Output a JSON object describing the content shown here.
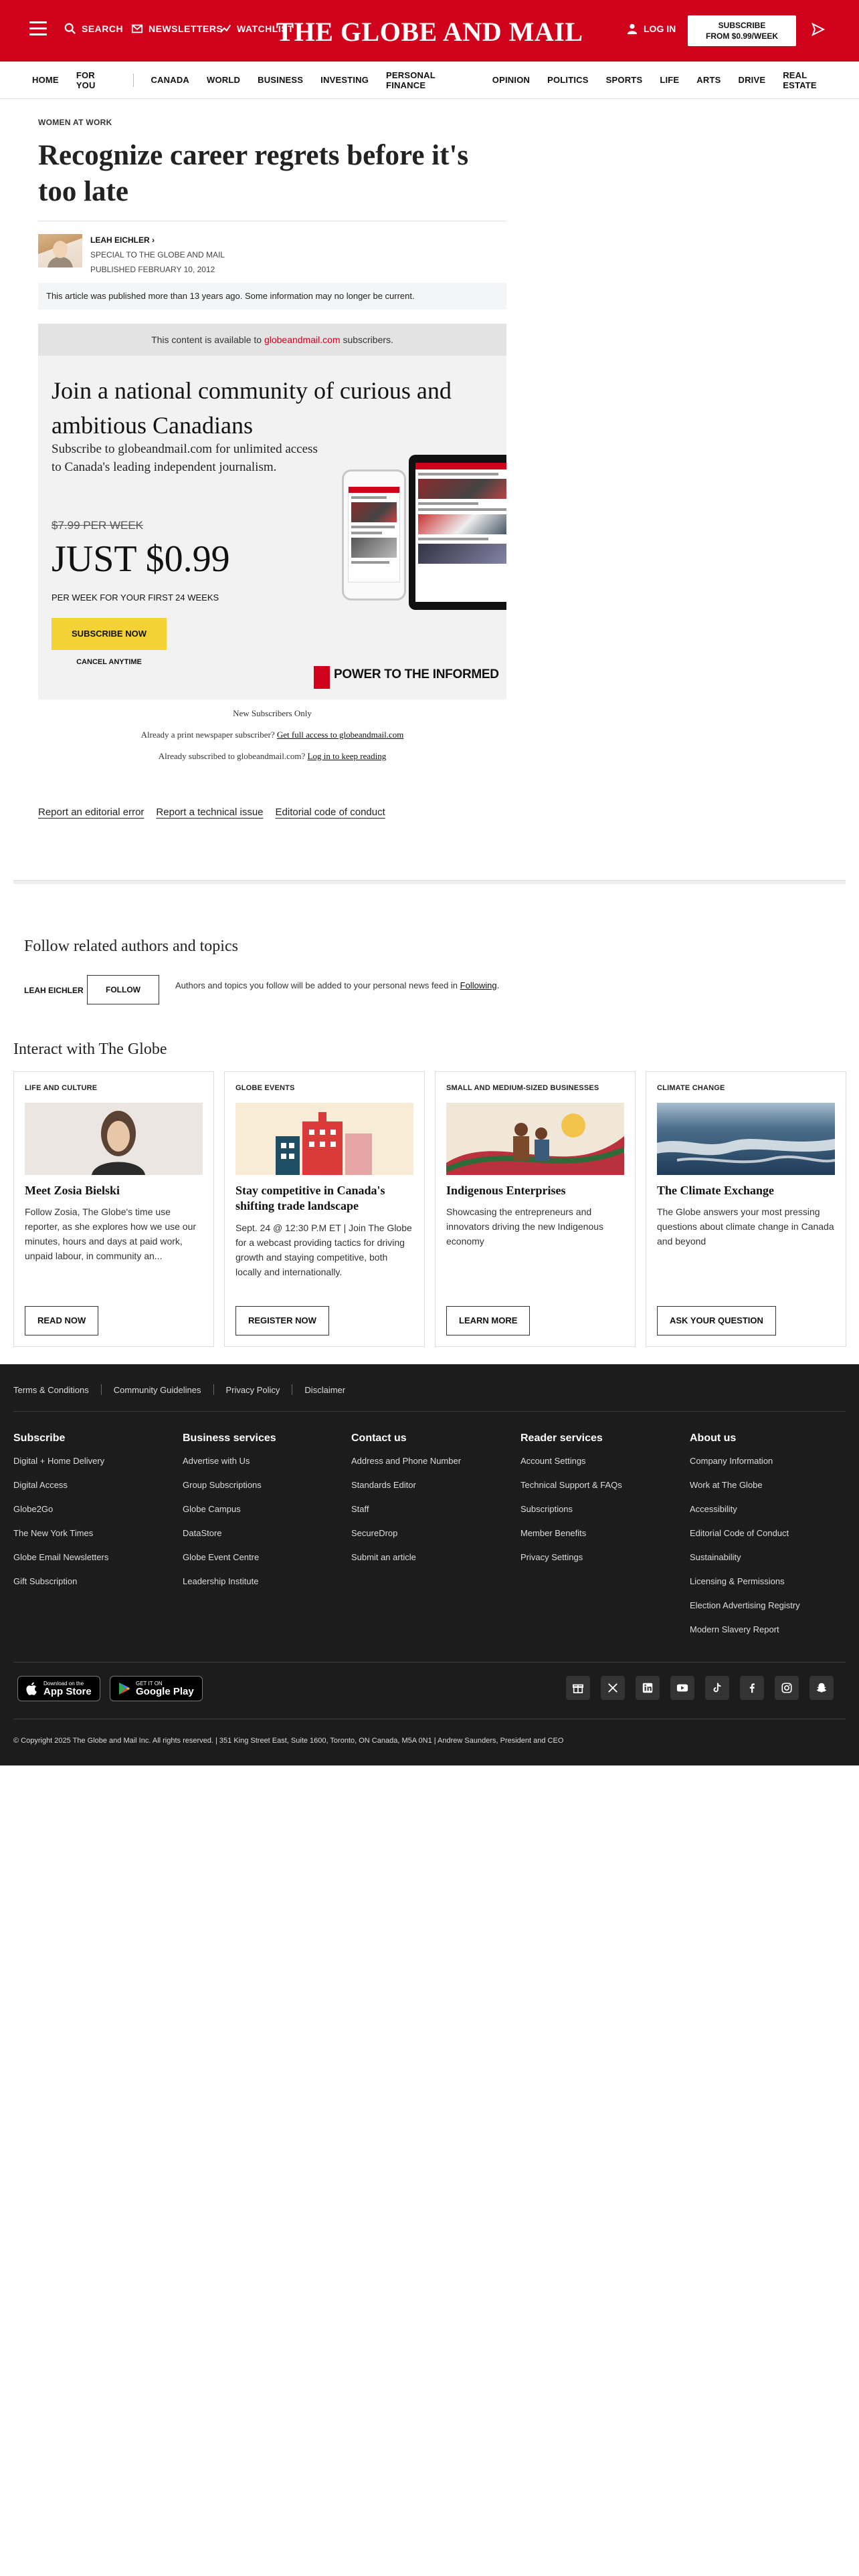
{
  "header": {
    "search_label": "SEARCH",
    "newsletters_label": "NEWSLETTERS",
    "watchlist_label": "WATCHLIST",
    "logo": "THE GLOBE AND MAIL",
    "login_label": "LOG IN",
    "subscribe_line1": "SUBSCRIBE",
    "subscribe_line2": "FROM $0.99/WEEK",
    "brand_color": "#d0021b"
  },
  "nav": {
    "items": [
      "HOME",
      "FOR YOU",
      "CANADA",
      "WORLD",
      "BUSINESS",
      "INVESTING",
      "PERSONAL FINANCE",
      "OPINION",
      "POLITICS",
      "SPORTS",
      "LIFE",
      "ARTS",
      "DRIVE",
      "REAL ESTATE"
    ]
  },
  "article": {
    "kicker": "WOMEN AT WORK",
    "headline": "Recognize career regrets before it's too late",
    "author": "LEAH EICHLER",
    "author_role": "SPECIAL TO THE GLOBE AND MAIL",
    "published": "PUBLISHED FEBRUARY 10, 2012",
    "old_notice": "This article was published more than 13 years ago. Some information may no longer be current."
  },
  "paywall": {
    "top_prefix": "This content is available to ",
    "top_link": "globeandmail.com",
    "top_suffix": " subscribers.",
    "title": "Join a national community of curious and ambitious Canadians",
    "description": "Subscribe to globeandmail.com for unlimited access to Canada's leading independent journalism.",
    "old_price": "$7.99 PER WEEK",
    "price": "JUST $0.99",
    "per_week": "PER WEEK FOR YOUR FIRST 24 WEEKS",
    "subscribe_button": "SUBSCRIBE NOW",
    "cancel": "CANCEL ANYTIME",
    "tagline": "POWER TO THE INFORMED",
    "button_color": "#f5d234"
  },
  "access": {
    "new_only": "New Subscribers Only",
    "print_prefix": "Already a print newspaper subscriber?",
    "print_link": "Get full access to globeandmail.com",
    "digital_prefix": "Already subscribed to globeandmail.com?",
    "digital_link": "Log in to keep reading"
  },
  "article_footer_links": [
    "Report an editorial error",
    "Report a technical issue",
    "Editorial code of conduct"
  ],
  "follow": {
    "title": "Follow related authors and topics",
    "name": "LEAH EICHLER",
    "button": "FOLLOW",
    "note_prefix": "Authors and topics you follow will be added to your personal news feed in",
    "note_link": "Following",
    "note_suffix": "."
  },
  "interact": {
    "title": "Interact with The Globe",
    "cards": [
      {
        "category": "LIFE AND CULTURE",
        "title": "Meet Zosia Bielski",
        "description": "Follow Zosia, The Globe's time use reporter, as she explores how we use our minutes, hours and days at paid work, unpaid labour, in community an...",
        "button": "READ NOW"
      },
      {
        "category": "GLOBE EVENTS",
        "title": "Stay competitive in Canada's shifting trade landscape",
        "description": "Sept. 24 @ 12:30 P.M ET | Join The Globe for a webcast providing tactics for driving growth and staying competitive, both locally and internationally.",
        "button": "REGISTER NOW"
      },
      {
        "category": "SMALL AND MEDIUM-SIZED BUSINESSES",
        "title": "Indigenous Enterprises",
        "description": "Showcasing the entrepreneurs and innovators driving the new Indigenous economy",
        "button": "LEARN MORE"
      },
      {
        "category": "CLIMATE CHANGE",
        "title": "The Climate Exchange",
        "description": "The Globe answers your most pressing questions about climate change in Canada and beyond",
        "button": "ASK YOUR QUESTION"
      }
    ]
  },
  "footer": {
    "legal": [
      "Terms & Conditions",
      "Community Guidelines",
      "Privacy Policy",
      "Disclaimer"
    ],
    "columns": [
      {
        "heading": "Subscribe",
        "links": [
          "Digital + Home Delivery",
          "Digital Access",
          "Globe2Go",
          "The New York Times",
          "Globe Email Newsletters",
          "Gift Subscription"
        ]
      },
      {
        "heading": "Business services",
        "links": [
          "Advertise with Us",
          "Group Subscriptions",
          "Globe Campus",
          "DataStore",
          "Globe Event Centre",
          "Leadership Institute"
        ]
      },
      {
        "heading": "Contact us",
        "links": [
          "Address and Phone Number",
          "Standards Editor",
          "Staff",
          "SecureDrop",
          "Submit an article"
        ]
      },
      {
        "heading": "Reader services",
        "links": [
          "Account Settings",
          "Technical Support & FAQs",
          "Subscriptions",
          "Member Benefits",
          "Privacy Settings"
        ]
      },
      {
        "heading": "About us",
        "links": [
          "Company Information",
          "Work at The Globe",
          "Accessibility",
          "Editorial Code of Conduct",
          "Sustainability",
          "Licensing & Permissions",
          "Election Advertising Registry",
          "Modern Slavery Report"
        ]
      }
    ],
    "app_store_small": "Download on the",
    "app_store": "App Store",
    "google_play_small": "GET IT ON",
    "google_play": "Google Play",
    "social_icons": [
      "gift-icon",
      "x-icon",
      "linkedin-icon",
      "youtube-icon",
      "tiktok-icon",
      "facebook-icon",
      "instagram-icon",
      "snapchat-icon"
    ],
    "copyright": "© Copyright 2025 The Globe and Mail Inc. All rights reserved.   |   351 King Street East, Suite 1600, Toronto, ON Canada, M5A 0N1   |   Andrew Saunders, President and CEO"
  }
}
